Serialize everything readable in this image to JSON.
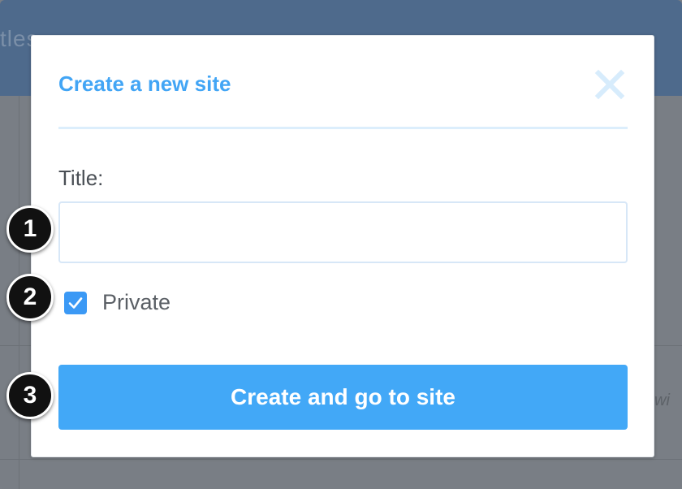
{
  "background": {
    "header_fragment": "tles",
    "right_fragment": "wi"
  },
  "modal": {
    "title": "Create a new site",
    "close_icon": "close-x-icon",
    "title_field": {
      "label": "Title:",
      "value": "",
      "placeholder": ""
    },
    "private_checkbox": {
      "label": "Private",
      "checked": true
    },
    "submit_label": "Create and go to site"
  },
  "annotations": {
    "step_1": "1",
    "step_2": "2",
    "step_3": "3"
  },
  "colors": {
    "accent": "#42a5f5",
    "button": "#42a8f7",
    "checkbox": "#3b99f5",
    "overlay": "#797e85",
    "header_bg": "#4e6a8c"
  }
}
